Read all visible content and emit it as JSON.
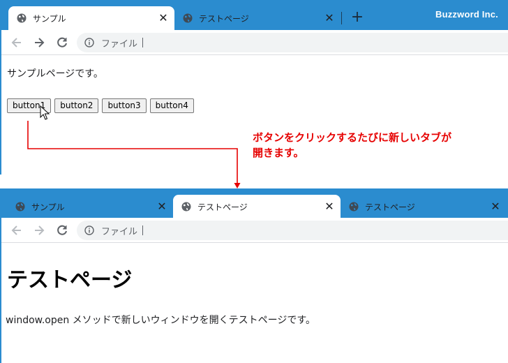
{
  "brand": "Buzzword Inc.",
  "annotation": {
    "line1": "ボタンをクリックするたびに新しいタブが",
    "line2": "開きます。",
    "color": "#e60000"
  },
  "colors": {
    "tabstrip": "#2b8ccf",
    "active_tab": "#ffffff",
    "omnibox": "#f1f3f4"
  },
  "window1": {
    "tabs": [
      {
        "title": "サンプル",
        "active": true,
        "icon": "globe-icon"
      },
      {
        "title": "テストページ",
        "active": false,
        "icon": "globe-icon"
      }
    ],
    "new_tab_label": "+",
    "omnibox_text": "ファイル",
    "page_text": "サンプルページです。",
    "buttons": [
      "button1",
      "button2",
      "button3",
      "button4"
    ]
  },
  "window2": {
    "tabs": [
      {
        "title": "サンプル",
        "active": false,
        "icon": "globe-icon"
      },
      {
        "title": "テストページ",
        "active": true,
        "icon": "globe-icon"
      },
      {
        "title": "テストページ",
        "active": false,
        "icon": "globe-icon"
      }
    ],
    "omnibox_text": "ファイル",
    "heading": "テストページ",
    "description": "window.open メソッドで新しいウィンドウを開くテストページです。"
  }
}
